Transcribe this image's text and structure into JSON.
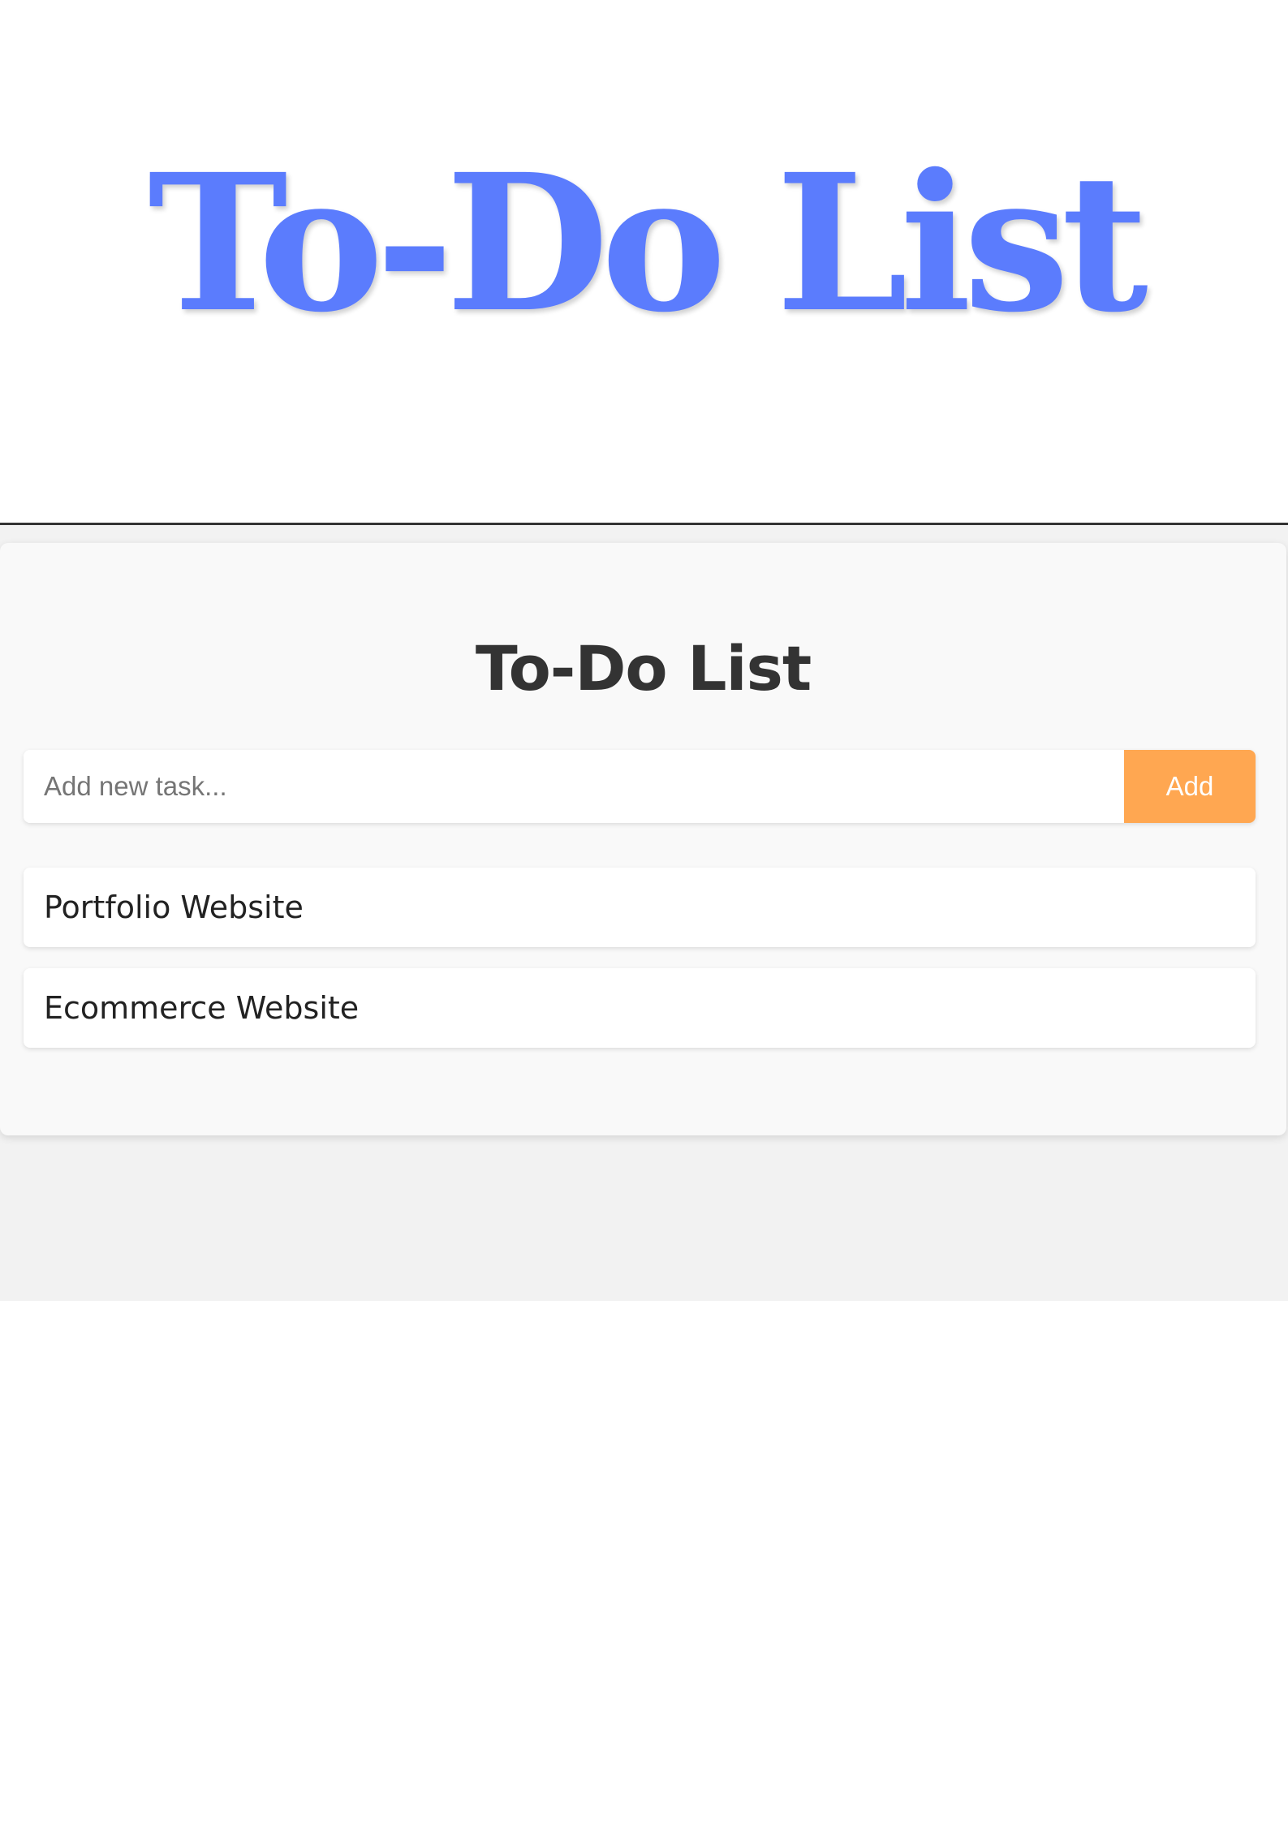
{
  "hero": {
    "title": "To-Do List"
  },
  "app": {
    "title": "To-Do List",
    "input": {
      "placeholder": "Add new task...",
      "value": ""
    },
    "add_button_label": "Add",
    "tasks": [
      {
        "label": "Portfolio Website"
      },
      {
        "label": "Ecommerce Website"
      }
    ]
  },
  "colors": {
    "hero_text": "#5b7cfd",
    "add_button": "#ffa751",
    "card_background": "#f9f9f9",
    "page_background": "#f2f2f2"
  }
}
